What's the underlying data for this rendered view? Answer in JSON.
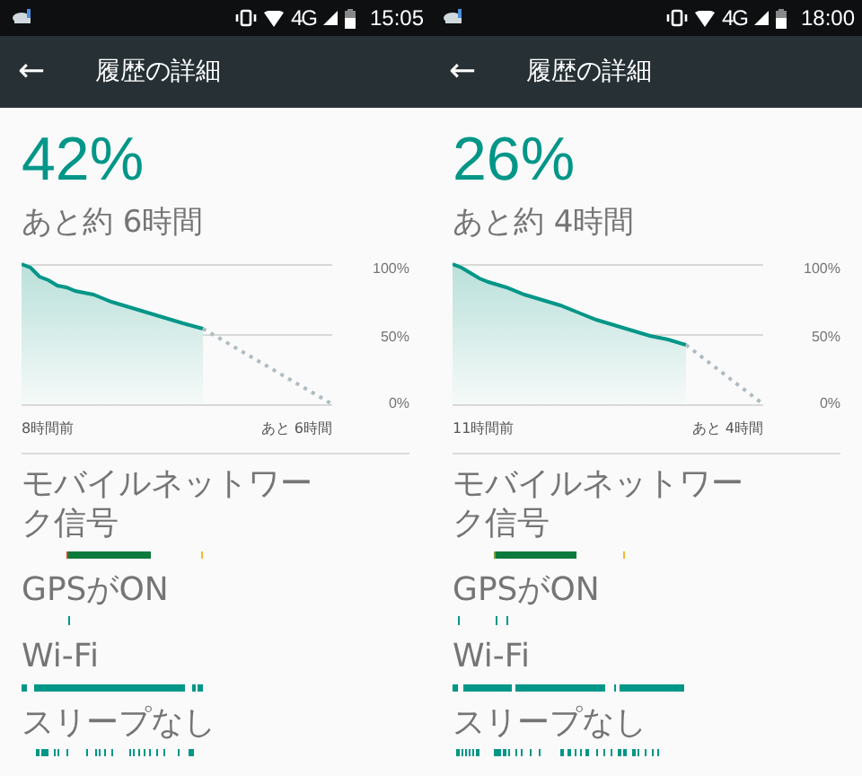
{
  "panels": [
    {
      "status_bar": {
        "network": "4G",
        "time": "15:05"
      },
      "toolbar": {
        "back": "←",
        "title": "履歴の詳細"
      },
      "charge": "42%",
      "remaining": "あと約 6時間",
      "chart": {
        "y_labels": [
          "100%",
          "50%",
          "0%"
        ],
        "start_label": "8時間前",
        "end_label": "あと 6時間"
      },
      "rows": [
        {
          "label": "モバイルネットワーク信号"
        },
        {
          "label": "GPSがON"
        },
        {
          "label": "Wi-Fi"
        },
        {
          "label": "スリープなし"
        }
      ]
    },
    {
      "status_bar": {
        "network": "4G",
        "time": "18:00"
      },
      "toolbar": {
        "back": "←",
        "title": "履歴の詳細"
      },
      "charge": "26%",
      "remaining": "あと約 4時間",
      "chart": {
        "y_labels": [
          "100%",
          "50%",
          "0%"
        ],
        "start_label": "11時間前",
        "end_label": "あと 4時間"
      },
      "rows": [
        {
          "label": "モバイルネットワーク信号"
        },
        {
          "label": "GPSがON"
        },
        {
          "label": "Wi-Fi"
        },
        {
          "label": "スリープなし"
        }
      ]
    }
  ]
}
